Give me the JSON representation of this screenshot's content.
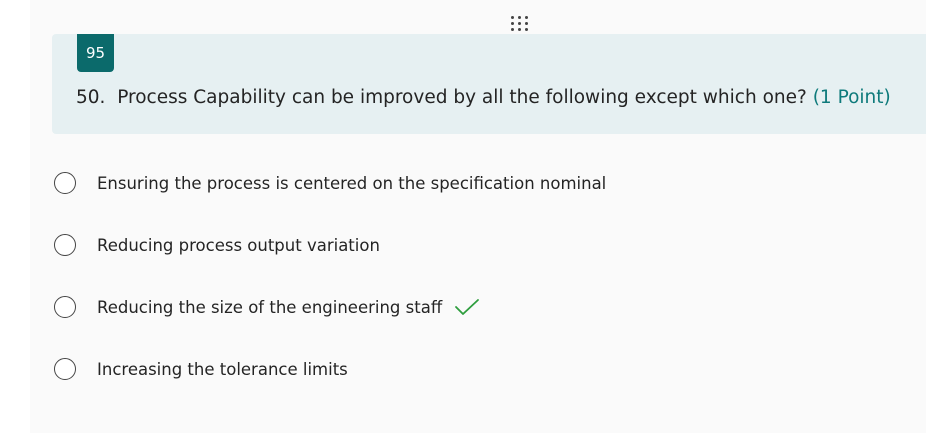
{
  "question": {
    "badge_number": "95",
    "number_prefix": "50.",
    "text": "Process Capability can be improved by all the following except which one?",
    "points_label": "(1 Point)"
  },
  "options": [
    {
      "label": "Ensuring the process is centered on the specification nominal",
      "selected": false,
      "correct": false
    },
    {
      "label": "Reducing process output variation",
      "selected": false,
      "correct": false
    },
    {
      "label": "Reducing the size of the engineering staff",
      "selected": false,
      "correct": true
    },
    {
      "label": "Increasing the tolerance limits",
      "selected": false,
      "correct": false
    }
  ],
  "colors": {
    "accent": "#0b6a6b",
    "header_bg": "#e6f0f2",
    "correct_check": "#2e9e3e"
  },
  "icons": {
    "drag": "drag-handle-icon",
    "correct": "checkmark-icon"
  }
}
